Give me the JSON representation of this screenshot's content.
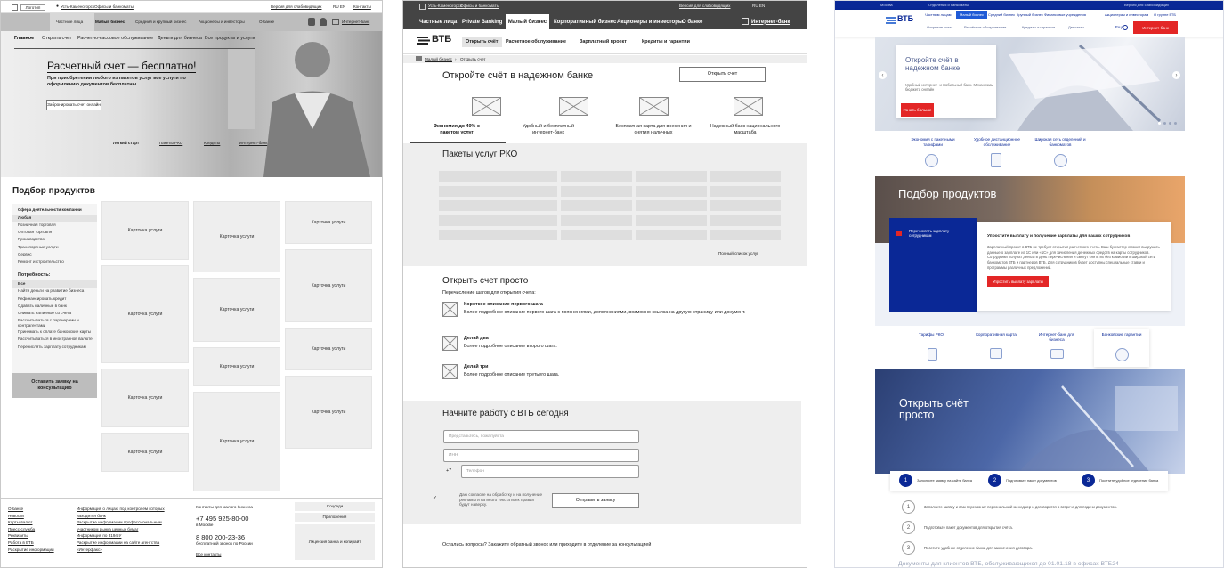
{
  "p1": {
    "logo": "Логотип",
    "city": "Усть-Каменогорск",
    "offices": "Офисы и банкоматы",
    "visually_impaired": "Версия для слабовидящих",
    "lang": "RU EN",
    "contacts": "Контакты",
    "nav": [
      "Частные лица",
      "Малый бизнес",
      "Средний и крупный бизнес",
      "Акционеры и инвесторы",
      "О банке"
    ],
    "internet_bank": "Интернет-банк",
    "subnav": [
      "Главное",
      "Открыть счет",
      "Расчетно-кассовое обслуживание",
      "Деньги для бизнеса",
      "Все продукты и услуги"
    ],
    "hero_title": "Расчетный счет — бесплатно!",
    "hero_text": "При приобретении любого из пакетов услуг все услуги по оформлению документов бесплатны.",
    "hero_button": "Забронировать счет онлайн",
    "hero_links": [
      "Легкий старт",
      "Пакеты РКО",
      "Кредиты",
      "Интернет-банк"
    ],
    "products_title": "Подбор продуктов",
    "sphere_title": "Сфера деятельности компании",
    "sphere_items": [
      "Любая",
      "Розничная торговля",
      "Оптовая торговля",
      "Производство",
      "Транспортные услуги",
      "Сервис",
      "Ремонт и строительство"
    ],
    "needs_title": "Потребность:",
    "needs_items": [
      "Все",
      "Найти деньги на развитие бизнеса",
      "Рефинансировать кредит",
      "Сдавать наличные в банк",
      "Снимать наличные со счета",
      "Рассчитываться с партнерами и контрагентами",
      "Принимать к оплате банковские карты",
      "Рассчитываться в иностранной валюте",
      "Перечислять зарплату сотрудникам"
    ],
    "consult_button": "Оставить заявку на консультацию",
    "card_label": "Карточка услуги",
    "footer_col1": [
      "О банке",
      "Новости",
      "Карты валют",
      "Пресс-служба",
      "Реквизиты",
      "Работа в ВТБ",
      "Раскрытие информации"
    ],
    "footer_col2": [
      "Информация о лицах, под контролем которых находится банк",
      "Раскрытие информации профессиональным участником рынка ценных бумаг",
      "Информация по 3194-У",
      "Раскрытие информации на сайте агентства «Интерфакс»"
    ],
    "footer_contacts_title": "Контакты для малого бизнеса",
    "phone1": "+7 495 925-80-00",
    "phone1_note": "в Москве",
    "phone2": "8 800 200-23-36",
    "phone2_note": "бесплатный звонок по России",
    "all_contacts": "Все контакты",
    "footer_buttons": [
      "Соцседи",
      "Приложения",
      "Лицензия банка и копирайт"
    ]
  },
  "p2": {
    "city": "Усть-Каменогорск",
    "offices": "Офисы и банкоматы",
    "visually_impaired": "Версия для слабовидящих",
    "lang": "RU EN",
    "nav": [
      "Частные лица",
      "Private Banking",
      "Малый бизнес",
      "Корпоративный бизнес",
      "Акционеры и инвесторы",
      "О банке"
    ],
    "internet_bank": "Интернет-банк",
    "logo": "ВТБ",
    "subnav": [
      "Открыть счёт",
      "Расчетное обслуживание",
      "Зарплатный проект",
      "Кредиты и гарантии"
    ],
    "breadcrumb": [
      "Малый бизнес",
      "Открыть счет"
    ],
    "open_title": "Откройте счёт в надежном банке",
    "open_button": "Открыть счет",
    "features": [
      "Экономия до 40% с пакетом услуг",
      "Удобный и бесплатный интернет-банк",
      "Бесплатная карта для внесения и снятия наличных",
      "Надежный банк национального масштаба"
    ],
    "packages_title": "Пакеты услуг РКО",
    "full_list": "Полный список услуг",
    "simple_title": "Открыть счет просто",
    "steps_intro": "Перечисление шагов для открытия счета:",
    "steps": [
      {
        "title": "Короткое описание первого шага",
        "desc": "Более подробное описание первого шага с пояснениями, дополнениями, возможно ссылка на другую страницу или документ."
      },
      {
        "title": "Делай два",
        "desc": "Более подробное описание второго шага."
      },
      {
        "title": "Делай три",
        "desc": "Более подробное описание третьего шага."
      }
    ],
    "form_title": "Начните работу с ВТБ сегодня",
    "name_placeholder": "Представьтесь, пожалуйста",
    "inn_placeholder": "ИНН",
    "phone_prefix": "+7",
    "phone_placeholder": "Телефон",
    "consent": "Даю согласие на обработку и на получение рекламы и на иного текста всех правил будут наверху.",
    "submit": "Отправить заявку",
    "bottom_text": "Остались вопросы? Закажите обратный звонок или приходите в отделение за консультацией"
  },
  "p3": {
    "city": "Москва",
    "offices": "Отделения и банкоматы",
    "visually_impaired": "Версия для слабовидящих",
    "logo": "ВТБ",
    "nav": [
      "Частным лицам",
      "Малый бизнес",
      "Средний бизнес",
      "Крупный бизнес",
      "Финансовые учреждения",
      "Акционерам и инвесторам",
      "О группе ВТБ"
    ],
    "subnav": [
      "Открытие счета",
      "Расчётное обслуживание",
      "Кредиты и гарантии",
      "Депозиты"
    ],
    "more": "Ещё",
    "internet_bank": "Интернет-банк",
    "slide_title": "Откройте счёт в надежном банке",
    "slide_text": "Удобный интернет- и мобильный банк. Механизмы бюджета онлайн",
    "slide_button": "Узнать больше",
    "benefits": [
      "Экономия с пакетными тарифами",
      "Удобное дистанционное обслуживание",
      "Широкая сеть отделений и банкоматов"
    ],
    "products_title": "Подбор продуктов",
    "card_tag": "Перечислять зарплату сотрудникам",
    "card_title": "Упростите выплату и получение зарплаты для ваших сотрудников",
    "card_text": "Зарплатный проект в ВТБ не требует открытия расчетного счета. Ваш бухгалтер сможет выгружать данные о зарплате из 1С или «1С» для зачисления денежных средств на карты сотрудников. Сотрудники получат деньги в день перечисления и смогут снять их без комиссии в широкой сети банкоматов ВТБ и партнеров ВТБ. Для сотрудников будет доступны специальные ставки и программы различных предложений.",
    "card_button": "Упростить выплату зарплаты",
    "product_tiles": [
      "Тарифы РКО",
      "Корпоративная карта",
      "Интернет-банк для бизнеса",
      "Банковские гарантии"
    ],
    "open_title": "Открыть счёт просто",
    "steps": [
      "Заполните заявку на сайте банка",
      "Подготовьте пакет документов",
      "Посетите удобное отделение банка"
    ],
    "step_details": [
      "Заполните заявку и вам перезвонит персональный менеджер и договорится о встрече для подачи документов.",
      "Подготовьте пакет документов для открытия счёта.",
      "Посетите удобное отделение банка для заключения договора."
    ],
    "bottom": "Документы для клиентов ВТБ, обслуживающихся до 01.01.18 в офисах ВТБ24"
  }
}
